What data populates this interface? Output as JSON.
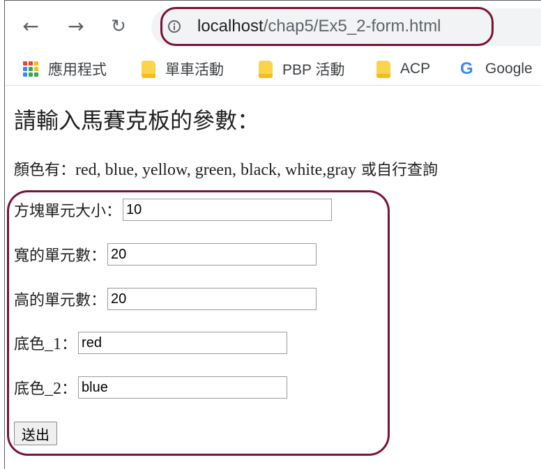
{
  "browser": {
    "url_host": "localhost",
    "url_path": "/chap5/Ex5_2-form.html",
    "highlight_color": "#7a1230"
  },
  "bookmarks": [
    {
      "label": "應用程式",
      "icon": "apps-grid-icon"
    },
    {
      "label": "單車活動",
      "icon": "folder-icon"
    },
    {
      "label": "PBP 活動",
      "icon": "folder-icon"
    },
    {
      "label": "ACP",
      "icon": "folder-icon"
    },
    {
      "label": "Google",
      "icon": "google-icon"
    }
  ],
  "page": {
    "title": "請輸入馬賽克板的參數：",
    "hint_prefix": "顏色有：",
    "hint_colors": "red, blue, yellow, green, black, white,gray",
    "hint_suffix": " 或自行查詢"
  },
  "form": {
    "fields": [
      {
        "label": "方塊單元大小：",
        "value": "10"
      },
      {
        "label": "寬的單元數：",
        "value": "20"
      },
      {
        "label": "高的單元數：",
        "value": "20"
      },
      {
        "label_main": "底色",
        "label_num": "_1",
        "label_colon": "：",
        "value": "red"
      },
      {
        "label_main": "底色",
        "label_num": "_2",
        "label_colon": "：",
        "value": "blue"
      }
    ],
    "submit_label": "送出"
  }
}
